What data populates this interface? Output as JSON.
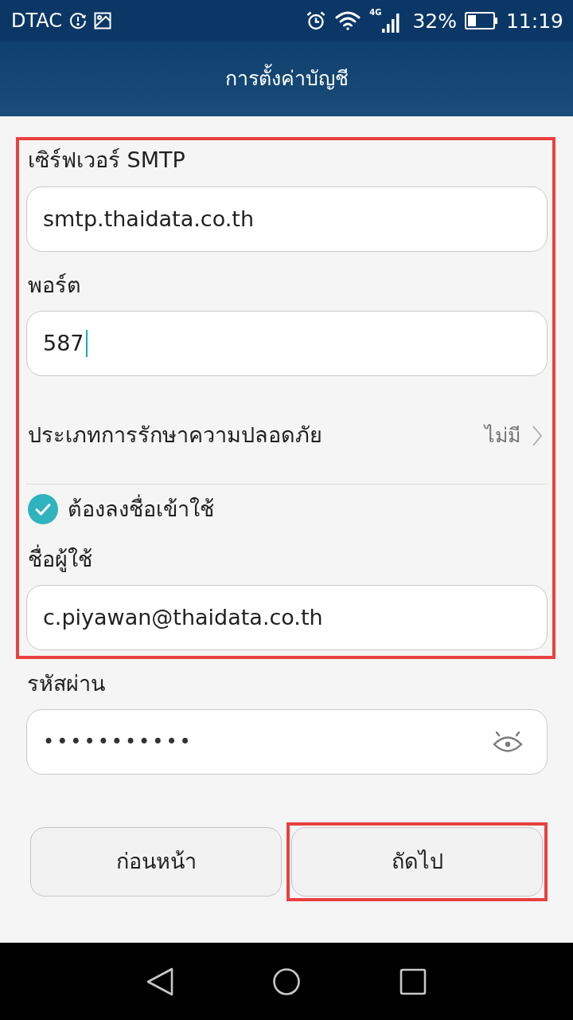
{
  "status_bar": {
    "carrier": "DTAC",
    "network": "4G",
    "battery": "32%",
    "time": "11:19"
  },
  "app_bar": {
    "title": "การตั้งค่าบัญชี"
  },
  "form": {
    "highlighted": true,
    "items": [
      {
        "kind": "field",
        "label": "เซิร์ฟเวอร์ SMTP",
        "value": "smtp.thaidata.co.th",
        "focused": false
      },
      {
        "kind": "field",
        "label": "พอร์ต",
        "value": "587",
        "focused": true
      },
      {
        "kind": "select",
        "label": "ประเภทการรักษาความปลอดภัย",
        "value": "ไม่มี"
      },
      {
        "kind": "checkbox",
        "label": "ต้องลงชื่อเข้าใช้",
        "checked": true
      },
      {
        "kind": "field",
        "label": "ชื่อผู้ใช้",
        "value": "c.piyawan@thaidata.co.th",
        "focused": false
      }
    ]
  },
  "password": {
    "label": "รหัสผ่าน",
    "value": "•••••••••••"
  },
  "buttons": [
    {
      "label": "ก่อนหน้า",
      "highlighted": false
    },
    {
      "label": "ถัดไป",
      "highlighted": true
    }
  ]
}
